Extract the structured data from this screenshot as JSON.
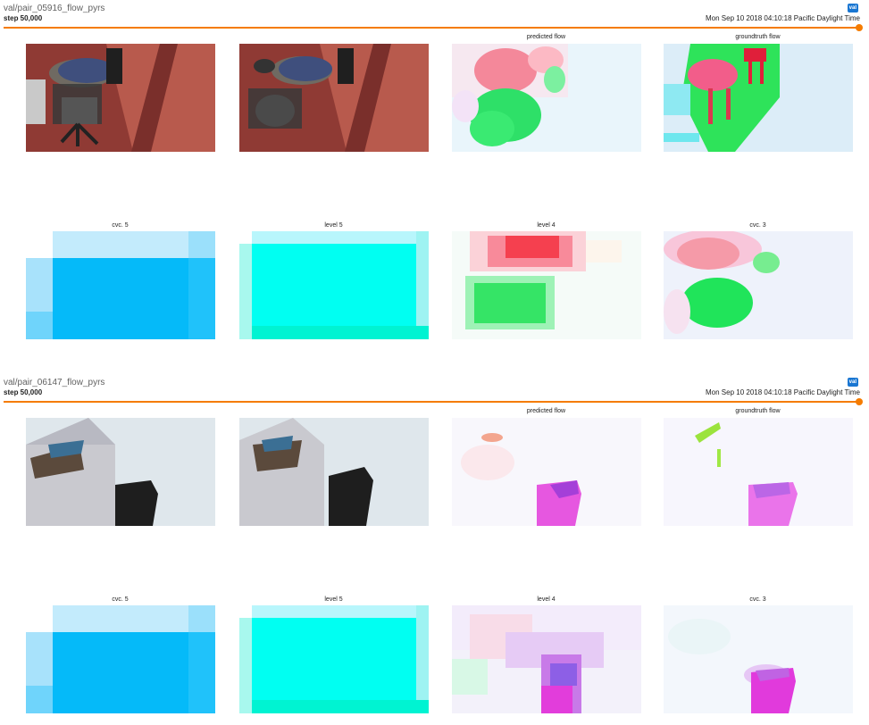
{
  "cards": [
    {
      "title": "val/pair_05916_flow_pyrs",
      "step": "step 50,000",
      "time": "Mon Sep 10 2018 04:10:18 Pacific Daylight Time",
      "tag": "val",
      "captions": [
        "predicted flow",
        "groundtruth flow",
        "cvc. 5",
        "level 5",
        "level 4",
        "cvc. 3"
      ]
    },
    {
      "title": "val/pair_06147_flow_pyrs",
      "step": "step 50,000",
      "time": "Mon Sep 10 2018 04:10:18 Pacific Daylight Time",
      "tag": "val",
      "captions": [
        "predicted flow",
        "groundtruth flow",
        "cvc. 5",
        "level 5",
        "level 4",
        "cvc. 3"
      ]
    }
  ]
}
